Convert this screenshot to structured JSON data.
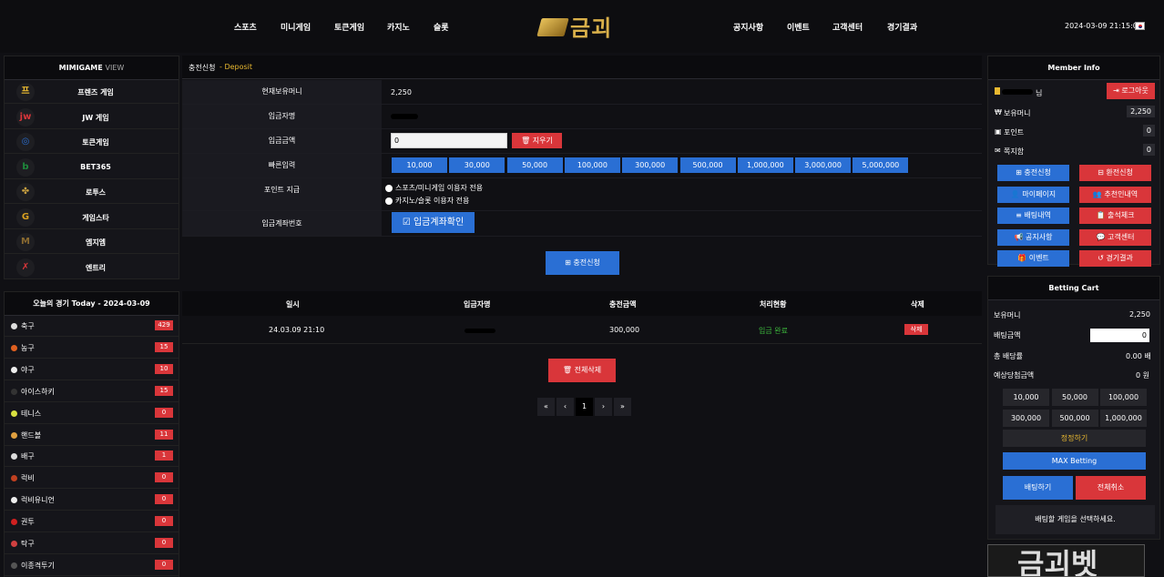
{
  "nav": {
    "left": [
      "스포츠",
      "미니게임",
      "토큰게임",
      "카지노",
      "슬롯"
    ],
    "right": [
      "공지사항",
      "이벤트",
      "고객센터",
      "경기결과"
    ],
    "logo_text": "금괴",
    "datetime": "2024-03-09 21:15:06"
  },
  "games_panel": {
    "title": "MIMIGAME",
    "title_suffix": "VIEW",
    "items": [
      {
        "label": "프렌즈 게임",
        "icon": "friends-icon"
      },
      {
        "label": "JW 게임",
        "icon": "jw-icon"
      },
      {
        "label": "토큰게임",
        "icon": "token-icon"
      },
      {
        "label": "BET365",
        "icon": "bet365-icon"
      },
      {
        "label": "로투스",
        "icon": "lotus-icon"
      },
      {
        "label": "게임스타",
        "icon": "gamestar-icon"
      },
      {
        "label": "엠지엠",
        "icon": "mgm-icon"
      },
      {
        "label": "엔트리",
        "icon": "entry-icon"
      }
    ]
  },
  "sports_panel": {
    "title": "오늘의 경기 Today - 2024-03-09",
    "items": [
      {
        "label": "축구",
        "count": "429",
        "color": "#dddddd"
      },
      {
        "label": "농구",
        "count": "15",
        "color": "#e06020"
      },
      {
        "label": "야구",
        "count": "10",
        "color": "#eeeeee"
      },
      {
        "label": "아이스하키",
        "count": "15",
        "color": "#333333"
      },
      {
        "label": "테니스",
        "count": "0",
        "color": "#d8e040"
      },
      {
        "label": "핸드볼",
        "count": "11",
        "color": "#e0a040"
      },
      {
        "label": "배구",
        "count": "1",
        "color": "#dddddd"
      },
      {
        "label": "럭비",
        "count": "0",
        "color": "#c04020"
      },
      {
        "label": "럭비유니언",
        "count": "0",
        "color": "#eeeeee"
      },
      {
        "label": "권투",
        "count": "0",
        "color": "#d02020"
      },
      {
        "label": "탁구",
        "count": "0",
        "color": "#d04040"
      },
      {
        "label": "이종격투기",
        "count": "0",
        "color": "#555555"
      }
    ]
  },
  "deposit": {
    "breadcrumb": "충전신청",
    "breadcrumb_sub": "Deposit",
    "rows": {
      "balance_label": "현재보유머니",
      "balance_value": "2,250",
      "depositor_label": "입금자명",
      "amount_label": "입금금액",
      "amount_value": "0",
      "clear_label": "지우기",
      "quick_label": "빠른입력",
      "point_label": "포인트 지급",
      "account_label": "입금계좌번호",
      "account_button": "입금계좌확인"
    },
    "quick_amounts": [
      "10,000",
      "30,000",
      "50,000",
      "100,000",
      "300,000",
      "500,000",
      "1,000,000",
      "3,000,000",
      "5,000,000"
    ],
    "point_options": [
      "스포츠/미니게임 이용자 전용",
      "카지노/슬롯 이용자 전용"
    ],
    "submit_label": "충전신청"
  },
  "history": {
    "headers": [
      "일시",
      "입금자명",
      "충전금액",
      "처리현황",
      "삭제"
    ],
    "rows": [
      {
        "date": "24.03.09 21:10",
        "amount": "300,000",
        "status": "입금 완료",
        "delete": "삭제"
      }
    ],
    "delete_all": "전체삭제",
    "pagination": [
      "«",
      "‹",
      "1",
      "›",
      "»"
    ]
  },
  "member": {
    "title": "Member Info",
    "suffix": "님",
    "logout": "로그아웃",
    "money_label": "보유머니",
    "money_value": "2,250",
    "point_label": "포인트",
    "point_value": "0",
    "notes_label": "쪽지함",
    "notes_value": "0",
    "buttons": [
      {
        "label": "충전신청",
        "color": "blue"
      },
      {
        "label": "환전신청",
        "color": "red"
      },
      {
        "label": "마이페이지",
        "color": "blue"
      },
      {
        "label": "추천인내역",
        "color": "red"
      },
      {
        "label": "배팅내역",
        "color": "blue"
      },
      {
        "label": "출석체크",
        "color": "red"
      },
      {
        "label": "공지사항",
        "color": "blue"
      },
      {
        "label": "고객센터",
        "color": "red"
      },
      {
        "label": "이벤트",
        "color": "blue"
      },
      {
        "label": "경기결과",
        "color": "red"
      }
    ]
  },
  "cart": {
    "title": "Betting Cart",
    "money_label": "보유머니",
    "money_value": "2,250",
    "bet_label": "배팅금액",
    "bet_value": "0",
    "odds_label": "총 배당률",
    "odds_value": "0.00 배",
    "expected_label": "예상당첨금액",
    "expected_value": "0 원",
    "amounts": [
      "10,000",
      "50,000",
      "100,000",
      "300,000",
      "500,000",
      "1,000,000"
    ],
    "reset": "정정하기",
    "max": "MAX Betting",
    "bet": "배팅하기",
    "cancel": "전체취소",
    "message": "배팅할 게임을 선택하세요."
  },
  "banner_text": "금괴벳"
}
